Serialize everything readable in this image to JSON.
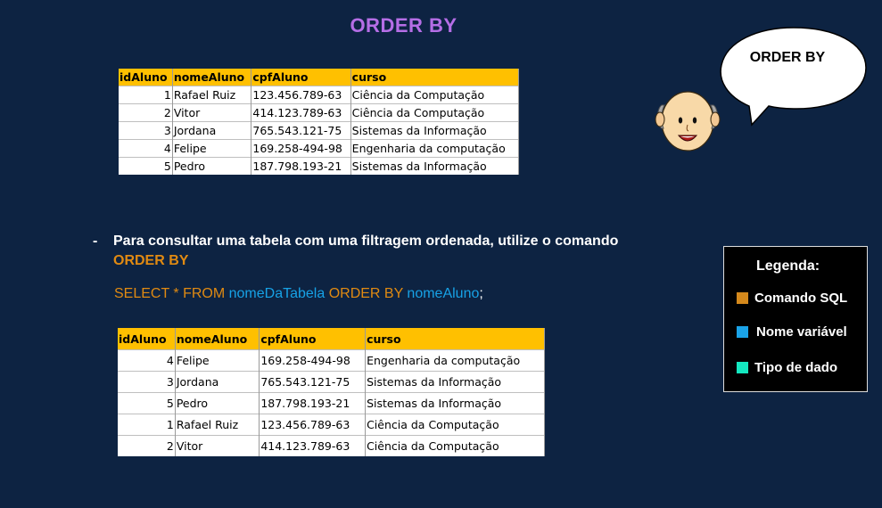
{
  "title": "ORDER BY",
  "table1": {
    "headers": [
      "idAluno",
      "nomeAluno",
      "cpfAluno",
      "curso"
    ],
    "rows": [
      [
        "1",
        "Rafael Ruiz",
        "123.456.789-63",
        "Ciência da Computação"
      ],
      [
        "2",
        "Vitor",
        "414.123.789-63",
        "Ciência da Computação"
      ],
      [
        "3",
        "Jordana",
        "765.543.121-75",
        "Sistemas da Informação"
      ],
      [
        "4",
        "Felipe",
        "169.258-494-98",
        "Engenharia da computação"
      ],
      [
        "5",
        "Pedro",
        "187.798.193-21",
        "Sistemas da Informação"
      ]
    ]
  },
  "instruction": {
    "dash": "-",
    "text": "Para consultar uma tabela com uma filtragem ordenada, utilize o comando ",
    "keyword": "ORDER BY"
  },
  "sql": {
    "part1": "SELECT * FROM ",
    "table": "nomeDaTabela",
    "part2": " ORDER BY ",
    "column": "nomeAluno",
    "end": ";"
  },
  "table2": {
    "headers": [
      "idAluno",
      "nomeAluno",
      "cpfAluno",
      "curso"
    ],
    "rows": [
      [
        "4",
        "Felipe",
        "169.258-494-98",
        "Engenharia da computação"
      ],
      [
        "3",
        "Jordana",
        "765.543.121-75",
        "Sistemas da Informação"
      ],
      [
        "5",
        "Pedro",
        "187.798.193-21",
        "Sistemas da Informação"
      ],
      [
        "1",
        "Rafael Ruiz",
        "123.456.789-63",
        "Ciência da Computação"
      ],
      [
        "2",
        "Vitor",
        "414.123.789-63",
        "Ciência da Computação"
      ]
    ]
  },
  "legend": {
    "title": "Legenda:",
    "items": [
      {
        "label": "Comando SQL",
        "color": "#d4891c"
      },
      {
        "label": "Nome variável",
        "color": "#1aa3e8"
      },
      {
        "label": "Tipo de dado",
        "color": "#14e8c0"
      }
    ]
  },
  "speech_bubble": {
    "text": "ORDER BY"
  }
}
